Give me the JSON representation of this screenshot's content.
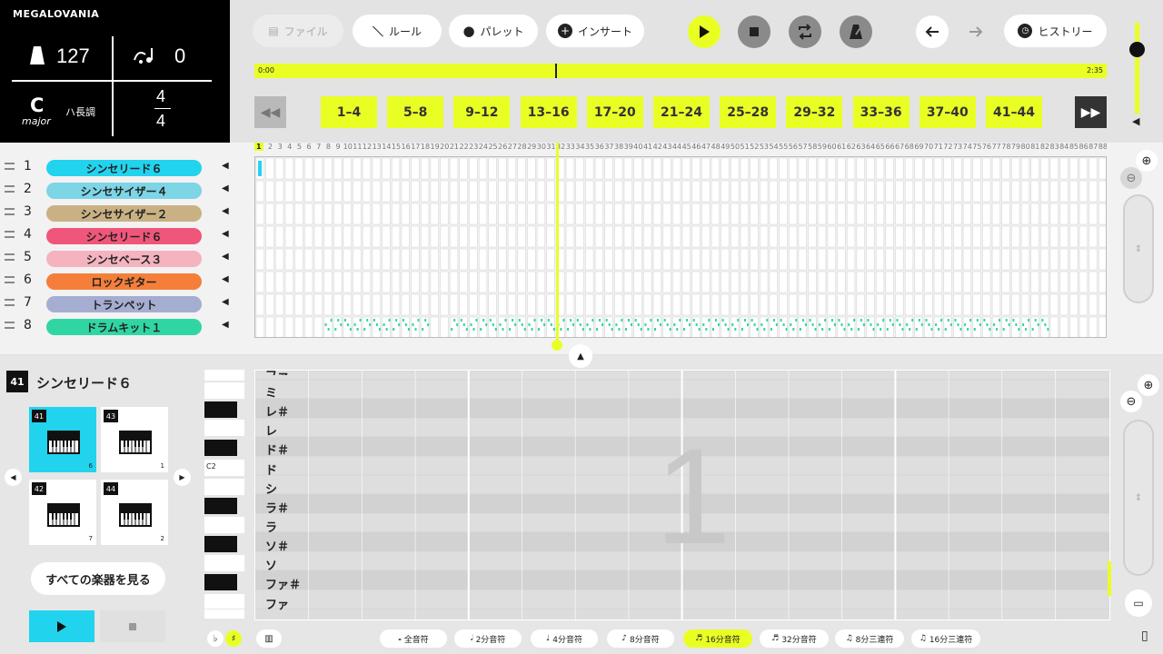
{
  "song": {
    "title": "MEGALOVANIA",
    "tempo": "127",
    "transpose": "0",
    "key": "C",
    "mode": "major",
    "key_jp": "ハ長調",
    "time_sig_top": "4",
    "time_sig_bottom": "4"
  },
  "toolbar": {
    "file": "ファイル",
    "rule": "ルール",
    "palette": "パレット",
    "insert": "インサート",
    "history": "ヒストリー"
  },
  "timeline": {
    "start": "0:00",
    "end": "2:35",
    "position": 0.353
  },
  "measures": [
    "1–4",
    "5–8",
    "9–12",
    "13–16",
    "17–20",
    "21–24",
    "25–28",
    "29–32",
    "33–36",
    "37–40",
    "41–44"
  ],
  "tracks": [
    {
      "num": "1",
      "name": "シンセリード６",
      "color": "#22d3ee"
    },
    {
      "num": "2",
      "name": "シンセサイザー４",
      "color": "#7dd5e6"
    },
    {
      "num": "3",
      "name": "シンセサイザー２",
      "color": "#c9b183"
    },
    {
      "num": "4",
      "name": "シンセリード６",
      "color": "#f0567a"
    },
    {
      "num": "5",
      "name": "シンセベース３",
      "color": "#f5b3c0"
    },
    {
      "num": "6",
      "name": "ロックギター",
      "color": "#f57f3a"
    },
    {
      "num": "7",
      "name": "トランペット",
      "color": "#a5aed1"
    },
    {
      "num": "8",
      "name": "ドラムキット１",
      "color": "#2fd6a4"
    }
  ],
  "ruler_first": "1",
  "instrument": {
    "number": "41",
    "name": "シンセリード６",
    "see_all": "すべての楽器を見る"
  },
  "inst_options": [
    {
      "num": "41",
      "count": "6",
      "selected": true
    },
    {
      "num": "43",
      "count": "1",
      "selected": false
    },
    {
      "num": "42",
      "count": "7",
      "selected": false
    },
    {
      "num": "44",
      "count": "2",
      "selected": false
    }
  ],
  "piano_roll": {
    "notes": [
      "ファ",
      "ミ",
      "レ＃",
      "レ",
      "ド＃",
      "ド",
      "シ",
      "ラ＃",
      "ラ",
      "ソ＃",
      "ソ",
      "ファ＃",
      "ファ"
    ],
    "c_label": "C2",
    "watermark": "1"
  },
  "note_lengths": [
    {
      "label": "全音符",
      "icon": "𝅝",
      "sel": false
    },
    {
      "label": "2分音符",
      "icon": "𝅗𝅥",
      "sel": false
    },
    {
      "label": "4分音符",
      "icon": "♩",
      "sel": false
    },
    {
      "label": "8分音符",
      "icon": "♪",
      "sel": false
    },
    {
      "label": "16分音符",
      "icon": "♬",
      "sel": true
    },
    {
      "label": "32分音符",
      "icon": "♬",
      "sel": false
    },
    {
      "label": "8分三連符",
      "icon": "♫",
      "sel": false
    },
    {
      "label": "16分三連符",
      "icon": "♫",
      "sel": false
    }
  ],
  "accidentals": {
    "flat": "♭",
    "sharp": "♯"
  },
  "colors": {
    "accent": "#e9ff24",
    "panel": "#000000",
    "selected": "#22d3ee"
  }
}
